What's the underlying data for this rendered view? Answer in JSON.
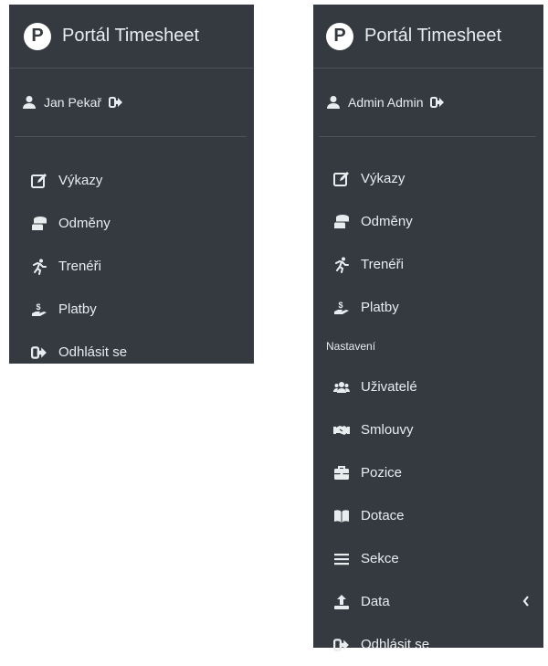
{
  "left_panel": {
    "brand": {
      "logo_letter": "P",
      "title": "Portál Timesheet"
    },
    "user": {
      "name": "Jan Pekař",
      "user_icon": "user-icon",
      "logout_icon": "sign-out-icon"
    },
    "menu": [
      {
        "label": "Výkazy",
        "icon": "edit-icon"
      },
      {
        "label": "Odměny",
        "icon": "coins-icon"
      },
      {
        "label": "Trenéři",
        "icon": "running-icon"
      },
      {
        "label": "Platby",
        "icon": "hand-holding-dollar-icon"
      },
      {
        "label": "Odhlásit se",
        "icon": "sign-out-icon"
      }
    ]
  },
  "right_panel": {
    "brand": {
      "logo_letter": "P",
      "title": "Portál Timesheet"
    },
    "user": {
      "name": "Admin Admin",
      "user_icon": "user-icon",
      "logout_icon": "sign-out-icon"
    },
    "menu": [
      {
        "label": "Výkazy",
        "icon": "edit-icon"
      },
      {
        "label": "Odměny",
        "icon": "coins-icon"
      },
      {
        "label": "Trenéři",
        "icon": "running-icon"
      },
      {
        "label": "Platby",
        "icon": "hand-holding-dollar-icon"
      }
    ],
    "settings_header": "Nastavení",
    "settings_menu": [
      {
        "label": "Uživatelé",
        "icon": "users-icon"
      },
      {
        "label": "Smlouvy",
        "icon": "handshake-icon"
      },
      {
        "label": "Pozice",
        "icon": "briefcase-icon"
      },
      {
        "label": "Dotace",
        "icon": "book-open-icon"
      },
      {
        "label": "Sekce",
        "icon": "bars-icon"
      },
      {
        "label": "Data",
        "icon": "upload-icon",
        "expand_icon": "chevron-left-icon"
      },
      {
        "label": "Odhlásit se",
        "icon": "sign-out-icon"
      }
    ]
  },
  "colors": {
    "sidebar_bg": "#343a40",
    "text": "#e9ecef",
    "divider": "#4b545c"
  }
}
